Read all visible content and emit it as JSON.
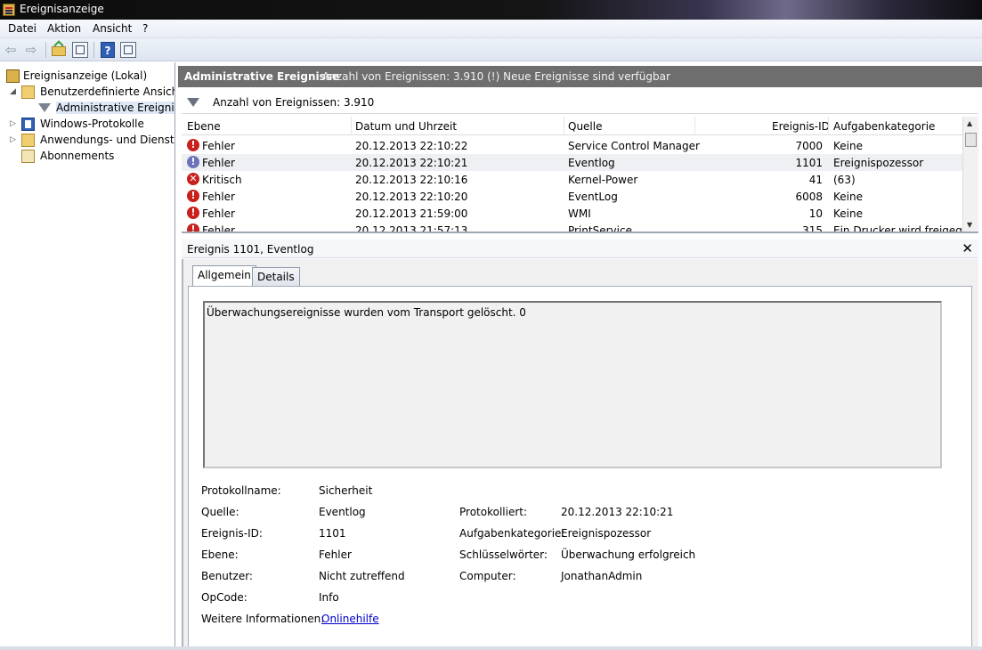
{
  "window": {
    "title": "Ereignisanzeige"
  },
  "menu": {
    "items": [
      "Datei",
      "Aktion",
      "Ansicht",
      "?"
    ]
  },
  "toolbar": {
    "back_icon": "back-arrow-icon",
    "forward_icon": "forward-arrow-icon",
    "up_icon": "folder-up-icon",
    "console_icon": "console-tree-icon",
    "help_icon": "help-icon",
    "help_label": "?",
    "action_pane_icon": "action-pane-icon"
  },
  "tree": {
    "items": [
      {
        "label": "Ereignisanzeige (Lokal)",
        "icon": "event-viewer-icon"
      },
      {
        "label": "Benutzerdefinierte Ansichten",
        "icon": "folder-icon",
        "expanded": true
      },
      {
        "label": "Administrative Ereignisse",
        "icon": "filter-icon",
        "selected": true
      },
      {
        "label": "Windows-Protokolle",
        "icon": "log-book-icon"
      },
      {
        "label": "Anwendungs- und Dienstprotokolle",
        "icon": "folder-icon"
      },
      {
        "label": "Abonnements",
        "icon": "subscription-icon"
      }
    ]
  },
  "header": {
    "title": "Administrative Ereignisse",
    "info": "Anzahl von Ereignissen: 3.910 (!) Neue Ereignisse sind verfügbar"
  },
  "filter": {
    "text": "Anzahl von Ereignissen: 3.910"
  },
  "grid": {
    "columns": [
      "Ebene",
      "Datum und Uhrzeit",
      "Quelle",
      "Ereignis-ID",
      "Aufgabenkategorie"
    ],
    "rows": [
      {
        "level": "Fehler",
        "level_icon": "error-icon",
        "datetime": "20.12.2013 22:10:22",
        "source": "Service Control Manager",
        "id": "7000",
        "category": "Keine"
      },
      {
        "level": "Fehler",
        "level_icon": "error-icon",
        "datetime": "20.12.2013 22:10:21",
        "source": "Eventlog",
        "id": "1101",
        "category": "Ereignispozessor",
        "selected": true
      },
      {
        "level": "Kritisch",
        "level_icon": "critical-icon",
        "datetime": "20.12.2013 22:10:16",
        "source": "Kernel-Power",
        "id": "41",
        "category": "(63)"
      },
      {
        "level": "Fehler",
        "level_icon": "error-icon",
        "datetime": "20.12.2013 22:10:20",
        "source": "EventLog",
        "id": "6008",
        "category": "Keine"
      },
      {
        "level": "Fehler",
        "level_icon": "error-icon",
        "datetime": "20.12.2013 21:59:00",
        "source": "WMI",
        "id": "10",
        "category": "Keine"
      },
      {
        "level": "Fehler",
        "level_icon": "error-icon",
        "datetime": "20.12.2013 21:57:13",
        "source": "PrintService",
        "id": "315",
        "category": "Ein Drucker wird freigeg..."
      }
    ]
  },
  "detail": {
    "title": "Ereignis 1101, Eventlog",
    "close_icon": "close-icon",
    "tabs": [
      "Allgemein",
      "Details"
    ],
    "message": "Überwachungsereignisse wurden vom Transport gelöscht. 0",
    "props": {
      "logname_label": "Protokollname:",
      "logname": "Sicherheit",
      "source_label": "Quelle:",
      "source": "Eventlog",
      "logged_label": "Protokolliert:",
      "logged": "20.12.2013 22:10:21",
      "eventid_label": "Ereignis-ID:",
      "eventid": "1101",
      "category_label": "Aufgabenkategorie:",
      "category": "Ereignispozessor",
      "level_label": "Ebene:",
      "level": "Fehler",
      "keywords_label": "Schlüsselwörter:",
      "keywords": "Überwachung erfolgreich",
      "user_label": "Benutzer:",
      "user": "Nicht zutreffend",
      "computer_label": "Computer:",
      "computer": "JonathanAdmin",
      "opcode_label": "OpCode:",
      "opcode": "Info",
      "moreinfo_label": "Weitere Informationen:",
      "moreinfo_link": "Onlinehilfe"
    }
  }
}
